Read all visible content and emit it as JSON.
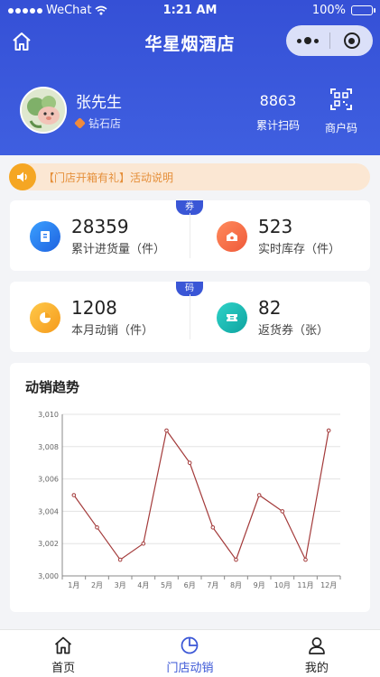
{
  "status_bar": {
    "carrier": "WeChat",
    "time": "1:21 AM",
    "battery": "100%"
  },
  "nav": {
    "title": "华星烟酒店"
  },
  "profile": {
    "name": "张先生",
    "level": "钻石店"
  },
  "header_stats": {
    "scan_count": "8863",
    "scan_label": "累计扫码",
    "merchant_label": "商户码"
  },
  "notice": {
    "text": "【门店开箱有礼】活动说明"
  },
  "card1": {
    "tag": "券",
    "left": {
      "value": "28359",
      "label": "累计进货量（件）",
      "color": "#2f7ff0"
    },
    "right": {
      "value": "523",
      "label": "实时库存（件）",
      "color": "#f46b45"
    }
  },
  "card2": {
    "tag": "码",
    "left": {
      "value": "1208",
      "label": "本月动销（件）",
      "color": "#f5a623"
    },
    "right": {
      "value": "82",
      "label": "返货券（张）",
      "color": "#15b6b0"
    }
  },
  "chart_data": {
    "type": "line",
    "title": "动销趋势",
    "categories": [
      "1月",
      "2月",
      "3月",
      "4月",
      "5月",
      "6月",
      "7月",
      "8月",
      "9月",
      "10月",
      "11月",
      "12月"
    ],
    "values": [
      3005,
      3003,
      3001,
      3002,
      3009,
      3007,
      3003,
      3001,
      3005,
      3004,
      3001,
      3009
    ],
    "yticks": [
      "3,000",
      "3,002",
      "3,004",
      "3,006",
      "3,008",
      "3,010"
    ],
    "ylim": [
      3000,
      3010
    ],
    "line_color": "#a33a3a",
    "grid": true
  },
  "tabbar": {
    "items": [
      {
        "label": "首页",
        "icon": "home-icon",
        "active": false
      },
      {
        "label": "门店动销",
        "icon": "pie-chart-icon",
        "active": true
      },
      {
        "label": "我的",
        "icon": "user-icon",
        "active": false
      }
    ]
  }
}
